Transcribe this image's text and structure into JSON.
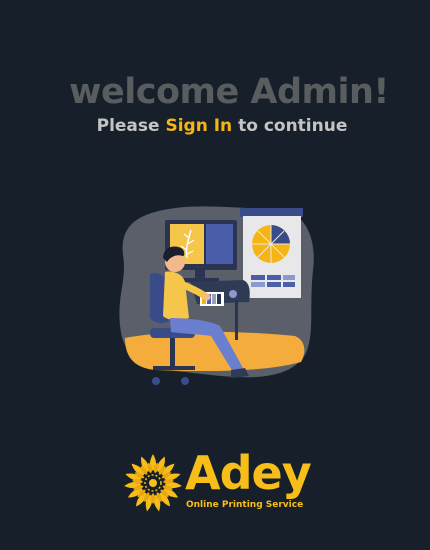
{
  "header": {
    "welcome_text": "welcome Admin!",
    "subtitle_prefix": "Please",
    "sign_in_link": "Sign In",
    "subtitle_suffix": "to continue"
  },
  "illustration": {
    "icon": "designer-at-workstation-illustration"
  },
  "brand": {
    "name": "Adey",
    "tagline": "Online Printing Service",
    "icon": "sunflower-logo-icon"
  },
  "colors": {
    "background": "#17202a",
    "welcome_text": "#5a5d60",
    "subtitle_text": "#c4c4c4",
    "accent": "#f5b515"
  }
}
